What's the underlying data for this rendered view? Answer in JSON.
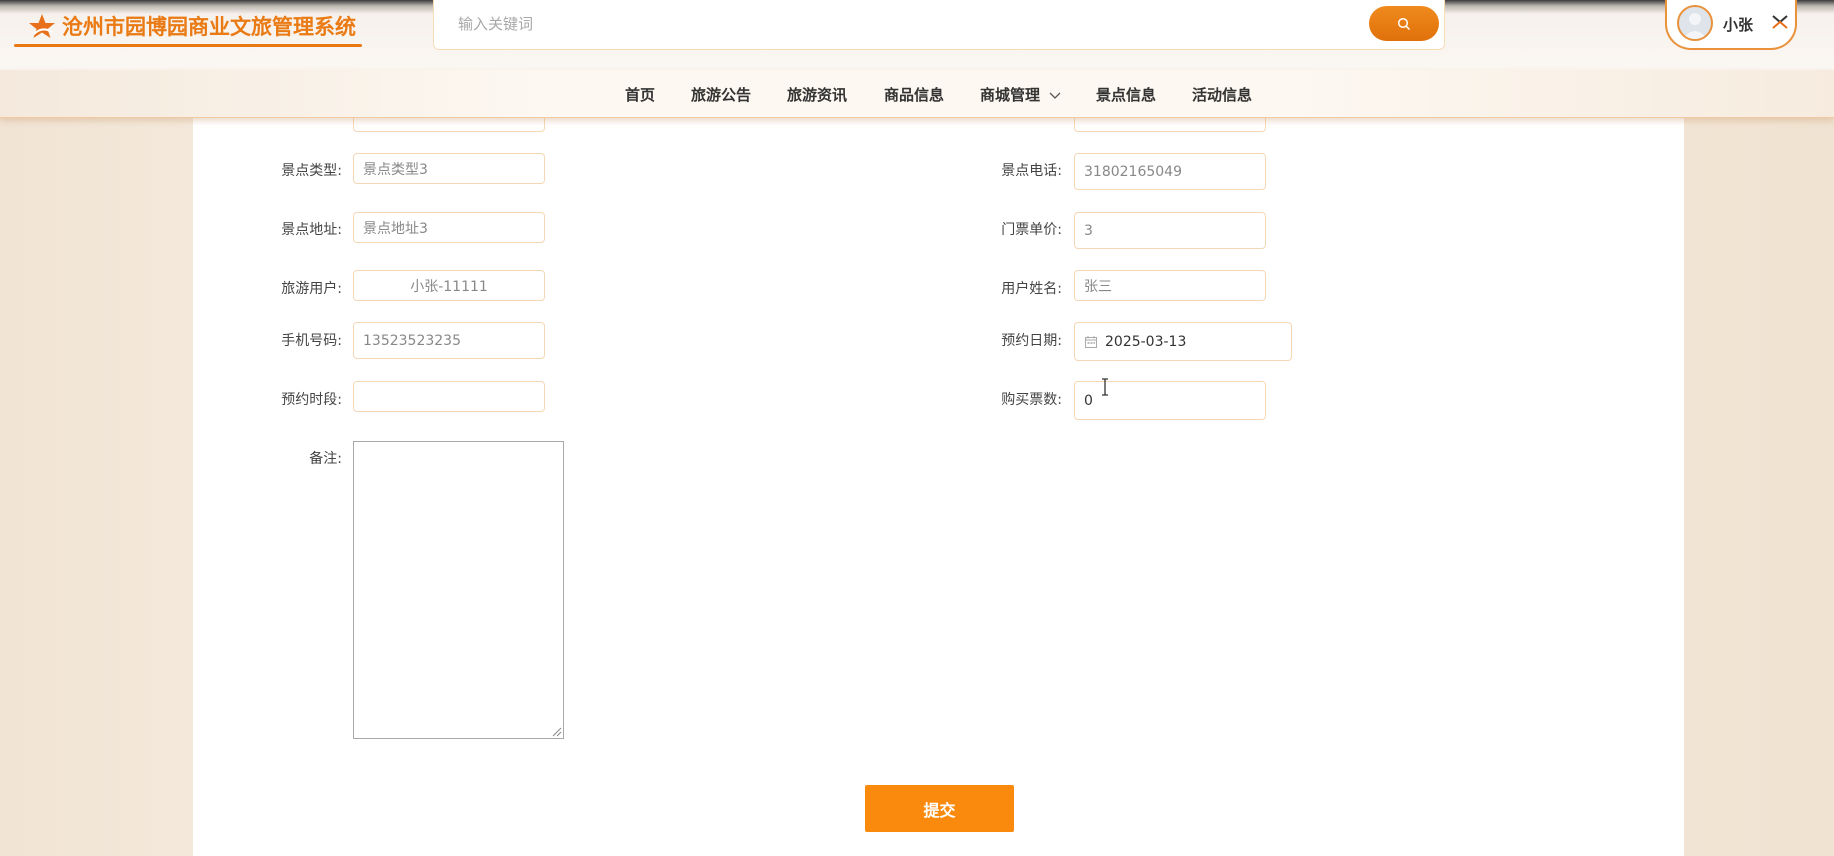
{
  "header": {
    "app_title": "沧州市园博园商业文旅管理系统",
    "search_placeholder": "输入关键词",
    "user_name": "小张"
  },
  "nav": {
    "items": [
      "首页",
      "旅游公告",
      "旅游资讯",
      "商品信息",
      "商城管理",
      "景点信息",
      "活动信息"
    ]
  },
  "form": {
    "left": [
      {
        "label": "景点类型:",
        "value": "景点类型3"
      },
      {
        "label": "景点地址:",
        "value": "景点地址3"
      },
      {
        "label": "旅游用户:",
        "value": "小张-11111"
      },
      {
        "label": "手机号码:",
        "value": "13523523235"
      },
      {
        "label": "预约时段:",
        "value": ""
      },
      {
        "label": "备注:",
        "value": ""
      }
    ],
    "right": [
      {
        "label": "景点电话:",
        "value": "31802165049"
      },
      {
        "label": "门票单价:",
        "value": "3"
      },
      {
        "label": "用户姓名:",
        "value": "张三"
      },
      {
        "label": "预约日期:",
        "value": "2025-03-13"
      },
      {
        "label": "购买票数:",
        "value": "0"
      }
    ],
    "submit_label": "提交"
  },
  "colors": {
    "accent": "#fa8a0e",
    "brand_text": "#ea7a14",
    "field_border": "#f6d7b5"
  }
}
